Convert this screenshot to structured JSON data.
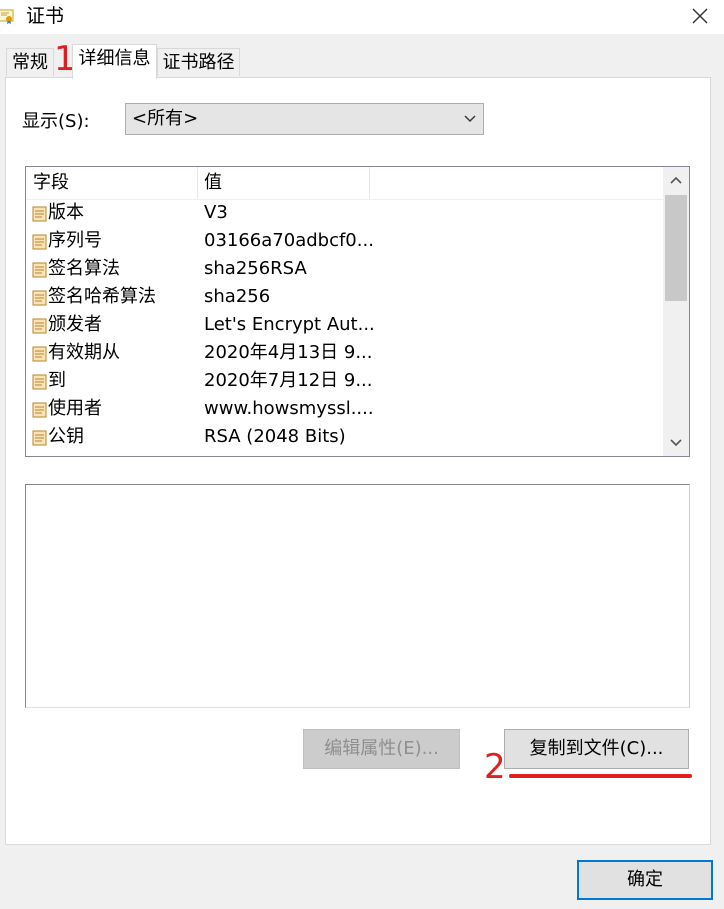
{
  "window": {
    "title": "证书",
    "close_icon": "close-icon"
  },
  "tabs": [
    {
      "label": "常规"
    },
    {
      "label": "详细信息",
      "active": true
    },
    {
      "label": "证书路径"
    }
  ],
  "show": {
    "label": "显示(S):",
    "selected": "<所有>"
  },
  "fields_list": {
    "columns": [
      "字段",
      "值"
    ],
    "rows": [
      {
        "field": "版本",
        "value": "V3"
      },
      {
        "field": "序列号",
        "value": "03166a70adbcf0..."
      },
      {
        "field": "签名算法",
        "value": "sha256RSA"
      },
      {
        "field": "签名哈希算法",
        "value": "sha256"
      },
      {
        "field": "颁发者",
        "value": "Let's Encrypt Aut..."
      },
      {
        "field": "有效期从",
        "value": "2020年4月13日 9..."
      },
      {
        "field": "到",
        "value": "2020年7月12日 9..."
      },
      {
        "field": "使用者",
        "value": "www.howsmyssl...."
      },
      {
        "field": "公钥",
        "value": "RSA (2048 Bits)"
      }
    ]
  },
  "buttons": {
    "edit_properties": "编辑属性(E)...",
    "copy_to_file": "复制到文件(C)...",
    "ok": "确定"
  },
  "annotations": {
    "step1": "1",
    "step2": "2",
    "color": "#e02020"
  }
}
